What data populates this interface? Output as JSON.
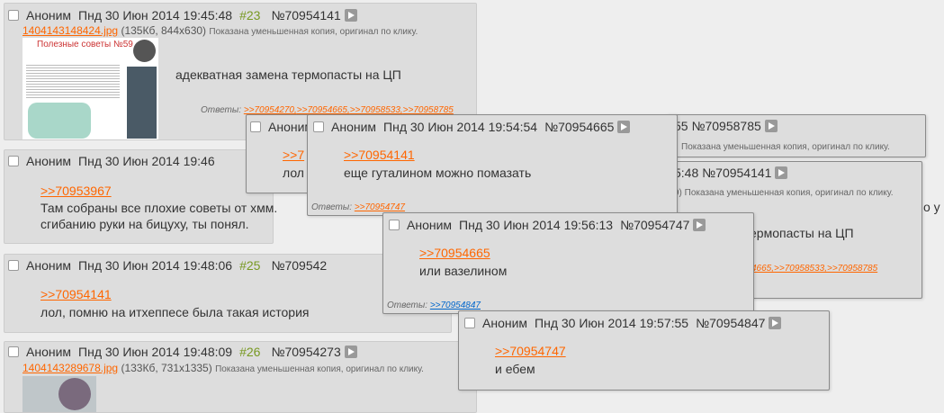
{
  "posts": [
    {
      "name": "Аноним",
      "date": "Пнд 30 Июн 2014 19:45:48",
      "num": "#23",
      "id": "№70954141",
      "file": {
        "link": "1404143148424.jpg",
        "info": "(135Кб, 844x630)",
        "note": "Показана уменьшенная копия, оригинал по клику."
      },
      "thumb": {
        "title": "Полезные советы №59"
      },
      "text": "адекватная замена термопасты на ЦП",
      "answers_label": "Ответы:",
      "answers": [
        ">>70954270,",
        ">>70954665,",
        ">>70958533,",
        ">>70958785"
      ]
    },
    {
      "name": "Аноним",
      "date": "Пнд 30 Июн 2014 19:46",
      "ref": ">>70953967",
      "lines": [
        "Там собраны все плохие советы от хмм.",
        "сгибанию руки на бицуху, ты понял."
      ]
    },
    {
      "name": "Аноним",
      "date": "Пнд 30 Июн 2014 19:48:06",
      "num": "#25",
      "id": "№709542",
      "ref": ">>70954141",
      "text": "лол, помню на итхеппесе была такая история"
    },
    {
      "name": "Аноним",
      "date": "Пнд 30 Июн 2014 19:48:09",
      "num": "#26",
      "id": "№70954273",
      "file": {
        "link": "1404143289678.jpg",
        "info": "(133Кб, 731x1335)",
        "note": "Показана уменьшенная копия, оригинал по клику."
      }
    }
  ],
  "popups": [
    {
      "name": "Аноним",
      "partial_ref": ">>7",
      "partial_text": "лол"
    },
    {
      "name": "Аноним",
      "date": "Пнд 30 Июн 2014 19:54:54",
      "id": "№70954665",
      "ref": ">>70954141",
      "text": "еще гуталином можно помазать",
      "answers_label": "Ответы:",
      "answers": [
        ">>70954747"
      ]
    },
    {
      "id": "55 №70958785",
      "note": "Показана уменьшенная копия, оригинал по клику."
    },
    {
      "date_frag": "5:48 №70954141",
      "note": "9) Показана уменьшенная копия, оригинал по клику.",
      "text_frag": "ермопасты на ЦП",
      "answers_frag": [
        "4665,",
        ">>70958533,",
        ">>70958785"
      ],
      "side_frag": "о у"
    },
    {
      "name": "Аноним",
      "date": "Пнд 30 Июн 2014 19:56:13",
      "id": "№70954747",
      "ref": ">>70954665",
      "text": "или вазелином",
      "answers_label": "Ответы:",
      "answers": [
        ">>70954847"
      ]
    },
    {
      "name": "Аноним",
      "date": "Пнд 30 Июн 2014 19:57:55",
      "id": "№70954847",
      "ref": ">>70954747",
      "text": "и ебем"
    }
  ]
}
